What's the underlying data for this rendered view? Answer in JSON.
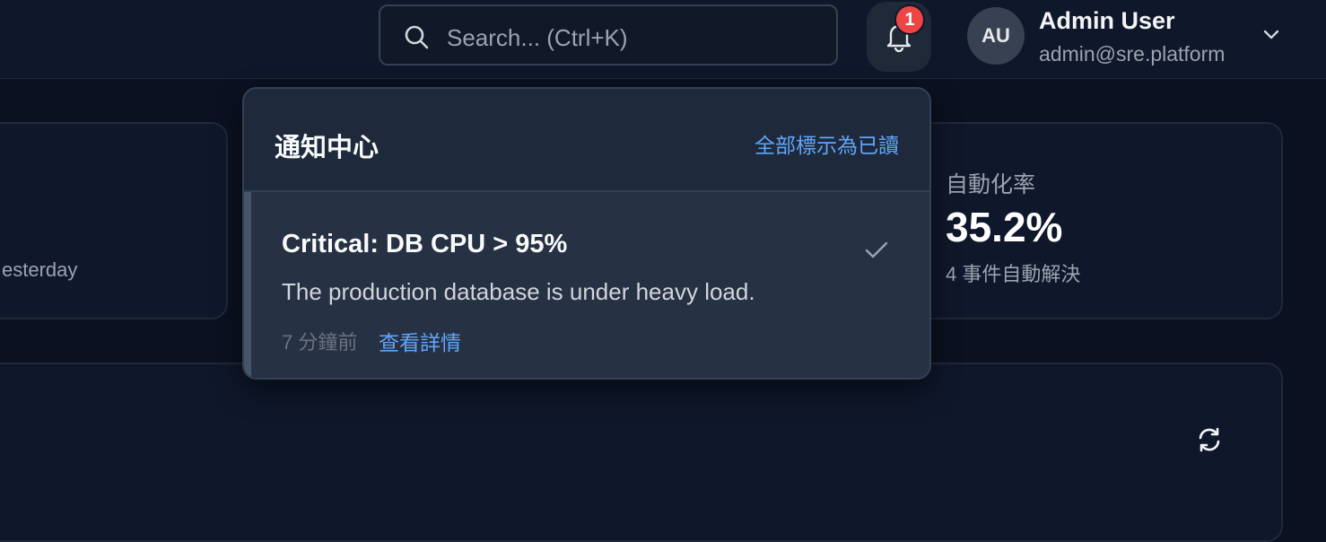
{
  "header": {
    "search": {
      "placeholder": "Search... (Ctrl+K)"
    },
    "notifications": {
      "badge_count": "1"
    },
    "user": {
      "initials": "AU",
      "name": "Admin User",
      "email": "admin@sre.platform"
    }
  },
  "cards": {
    "left": {
      "subtext": "esterday"
    },
    "right": {
      "label": "自動化率",
      "value": "35.2%",
      "subtext": "4 事件自動解決"
    }
  },
  "notification_center": {
    "title": "通知中心",
    "mark_all_read": "全部標示為已讀",
    "items": [
      {
        "title": "Critical: DB CPU > 95%",
        "body": "The production database is under heavy load.",
        "time": "7 分鐘前",
        "link": "查看詳情"
      }
    ]
  },
  "icons": {
    "search": "search-icon",
    "bell": "bell-icon",
    "chevron": "chevron-down-icon",
    "check": "check-icon",
    "refresh": "refresh-icon"
  },
  "colors": {
    "accent": "#60a5fa",
    "badge": "#ef4444",
    "background": "#0b1120",
    "panel": "#1e293b"
  }
}
